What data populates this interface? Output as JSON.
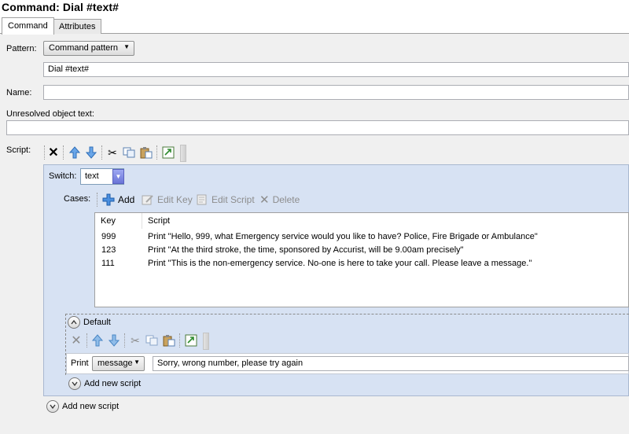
{
  "window": {
    "title": "Command: Dial #text#"
  },
  "tabs": [
    {
      "label": "Command",
      "active": true
    },
    {
      "label": "Attributes",
      "active": false
    }
  ],
  "form": {
    "pattern_label": "Pattern:",
    "pattern_value": "Command pattern",
    "pattern_text": "Dial #text#",
    "name_label": "Name:",
    "name_value": "",
    "unresolved_label": "Unresolved object text:",
    "unresolved_value": "",
    "script_label": "Script:"
  },
  "script_toolbar": {
    "icons": [
      "delete-icon",
      "move-up-icon",
      "move-down-icon",
      "cut-icon",
      "copy-icon",
      "paste-icon",
      "popout-icon"
    ]
  },
  "switch_block": {
    "switch_label": "Switch:",
    "switch_value": "text",
    "cases_label": "Cases:",
    "cases_toolbar": {
      "add": "Add",
      "edit_key": "Edit Key",
      "edit_script": "Edit Script",
      "delete": "Delete"
    },
    "columns": [
      "Key",
      "Script"
    ],
    "rows": [
      {
        "key": "999",
        "script": "Print \"Hello, 999, what Emergency service would you like to have? Police, Fire Brigade or Ambulance\""
      },
      {
        "key": "123",
        "script": "Print \"At the third stroke, the time, sponsored by Accurist, will be 9.00am precisely\""
      },
      {
        "key": "111",
        "script": "Print \"This is the non-emergency service. No-one is here to take your call. Please leave a message.\""
      }
    ],
    "default_label": "Default",
    "print_label": "Print",
    "print_mode": "message",
    "print_text": "Sorry, wrong number, please try again",
    "inner_add_new_script": "Add new script"
  },
  "add_new_script": "Add new script",
  "colors": {
    "panel": "#d7e2f3",
    "accent": "#2b6fd6",
    "page": "#f0f0f0"
  }
}
